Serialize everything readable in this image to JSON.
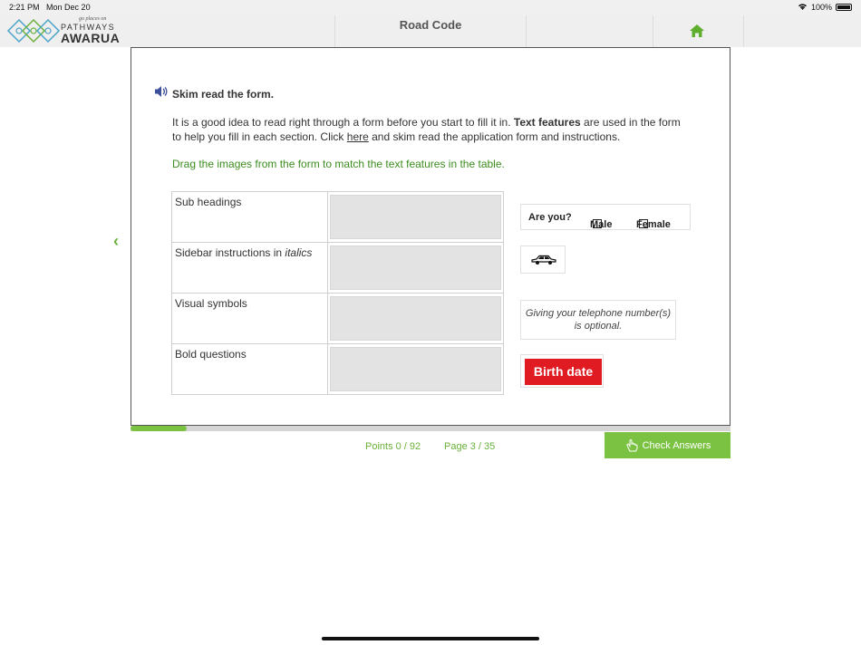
{
  "status_bar": {
    "time": "2:21 PM",
    "date": "Mon Dec 20",
    "battery": "100%"
  },
  "header": {
    "logo_tagline": "go places on",
    "logo_line1": "PATHWAYS",
    "logo_line2": "AWARUA",
    "title": "Road Code",
    "home_icon": "home-icon"
  },
  "content": {
    "heading": "Skim read the form.",
    "paragraph_part1": "It is a good idea to read right through a form before you start to fill it in. ",
    "paragraph_bold": "Text features",
    "paragraph_part2": " are used in the form to help you fill in each section. Click ",
    "paragraph_link": "here",
    "paragraph_part3": " and skim read the application form and instructions.",
    "instruction": "Drag the images from the form to match the text features in the table.",
    "rows": [
      {
        "label": "Sub headings"
      },
      {
        "label_prefix": "Sidebar instructions in ",
        "label_italic": "italics"
      },
      {
        "label": "Visual symbols"
      },
      {
        "label": "Bold questions"
      }
    ],
    "tiles": {
      "question": "Are you?",
      "male": "Male",
      "female": "Female",
      "car_icon": "car-icon",
      "optional_line1": "Giving your telephone number(s)",
      "optional_line2": "is optional.",
      "birth_date": "Birth date"
    }
  },
  "footer": {
    "points": "Points 0 / 92",
    "page": "Page 3 / 35",
    "progress_fraction": 0.094,
    "check_answers": "Check Answers"
  },
  "colors": {
    "accent_green": "#7cc242",
    "text_green": "#3c8c1e",
    "birth_red": "#e01b22"
  }
}
